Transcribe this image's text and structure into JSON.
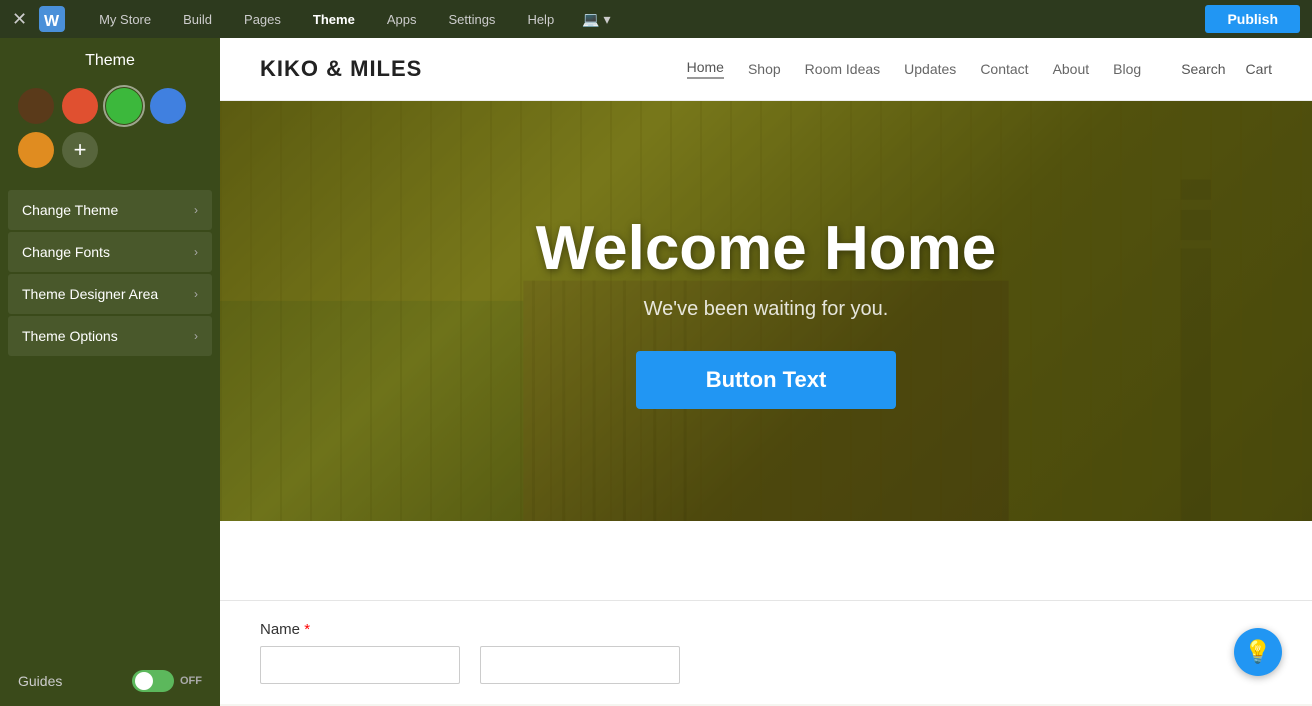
{
  "topNav": {
    "items": [
      {
        "label": "My Store",
        "active": false
      },
      {
        "label": "Build",
        "active": false
      },
      {
        "label": "Pages",
        "active": false
      },
      {
        "label": "Theme",
        "active": true
      },
      {
        "label": "Apps",
        "active": false
      },
      {
        "label": "Settings",
        "active": false
      },
      {
        "label": "Help",
        "active": false,
        "hasDropdown": true
      }
    ],
    "publishLabel": "Publish",
    "deviceIcon": "💻"
  },
  "sidebar": {
    "title": "Theme",
    "swatches": [
      {
        "color": "#5a3a1a",
        "label": "dark-brown"
      },
      {
        "color": "#e05030",
        "label": "red-orange"
      },
      {
        "color": "#3cb83c",
        "label": "green",
        "selected": true
      },
      {
        "color": "#4080e0",
        "label": "blue"
      }
    ],
    "extraSwatch": {
      "color": "#e08c20",
      "label": "orange"
    },
    "addLabel": "+",
    "menuItems": [
      {
        "label": "Change Theme",
        "id": "change-theme"
      },
      {
        "label": "Change Fonts",
        "id": "change-fonts"
      },
      {
        "label": "Theme Designer Area",
        "id": "theme-designer-area"
      },
      {
        "label": "Theme Options",
        "id": "theme-options"
      }
    ],
    "guidesLabel": "Guides",
    "toggleState": "OFF"
  },
  "website": {
    "logoText": "KIKO & MILES",
    "nav": [
      {
        "label": "Home",
        "active": true
      },
      {
        "label": "Shop",
        "active": false
      },
      {
        "label": "Room Ideas",
        "active": false
      },
      {
        "label": "Updates",
        "active": false
      },
      {
        "label": "Contact",
        "active": false
      },
      {
        "label": "About",
        "active": false
      },
      {
        "label": "Blog",
        "active": false
      }
    ],
    "actions": [
      {
        "label": "Search"
      },
      {
        "label": "Cart"
      }
    ],
    "hero": {
      "title": "Welcome Home",
      "subtitle": "We've been waiting for you.",
      "buttonText": "Button Text"
    },
    "formSection": {
      "nameLabel": "Name",
      "required": true
    }
  },
  "floatingBtn": {
    "icon": "💡"
  }
}
